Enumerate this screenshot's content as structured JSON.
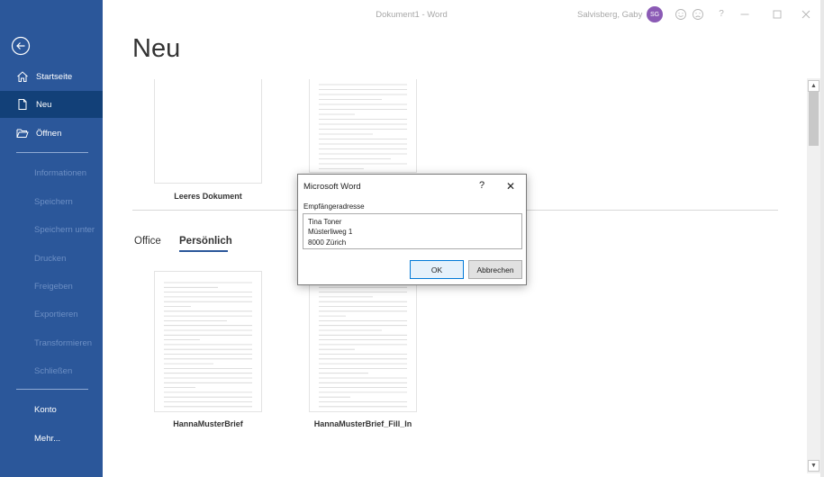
{
  "window": {
    "doc_title": "Dokument1  -  Word",
    "user_name": "Salvisberg, Gaby",
    "avatar_initials": "SG",
    "help": "?"
  },
  "sidebar": {
    "items": [
      {
        "label": "Startseite",
        "icon": "home-icon"
      },
      {
        "label": "Neu",
        "icon": "new-document-icon",
        "active": true
      },
      {
        "label": "Öffnen",
        "icon": "open-folder-icon"
      }
    ],
    "disabled_items": [
      "Informationen",
      "Speichern",
      "Speichern unter",
      "Drucken",
      "Freigeben",
      "Exportieren",
      "Transformieren",
      "Schließen"
    ],
    "bottom_items": [
      "Konto",
      "Mehr..."
    ]
  },
  "main": {
    "page_title": "Neu",
    "templates_top": [
      {
        "label": "Leeres Dokument"
      },
      {
        "label": ""
      }
    ],
    "tabs": [
      {
        "label": "Office",
        "active": false
      },
      {
        "label": "Persönlich",
        "active": true
      }
    ],
    "templates_personal": [
      {
        "label": "HannaMusterBrief"
      },
      {
        "label": "HannaMusterBrief_Fill_In"
      }
    ]
  },
  "dialog": {
    "title": "Microsoft Word",
    "help_label": "?",
    "close_label": "✕",
    "field_label": "Empfängeradresse",
    "field_value": "Tina Toner\nMüsterliweg 1\n8000 Zürich",
    "ok_label": "OK",
    "cancel_label": "Abbrechen"
  },
  "colors": {
    "sidebar": "#2b579a",
    "sidebar_active": "#124078",
    "avatar": "#8b5ab5",
    "accent": "#2b579a"
  }
}
